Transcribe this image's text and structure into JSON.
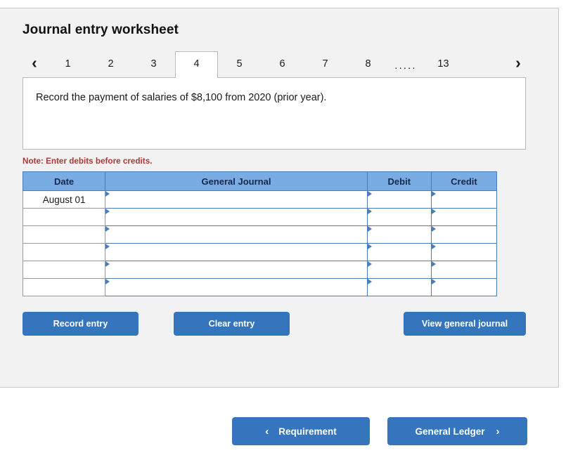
{
  "worksheet": {
    "title": "Journal entry worksheet",
    "prev_arrow": "‹",
    "next_arrow": "›",
    "tabs": [
      "1",
      "2",
      "3",
      "4",
      "5",
      "6",
      "7",
      "8"
    ],
    "tabs_ellipsis": ".....",
    "last_tab": "13",
    "active_tab": "4",
    "prompt": "Record the payment of salaries of $8,100 from 2020 (prior year).",
    "note": "Note: Enter debits before credits.",
    "table": {
      "headers": {
        "date": "Date",
        "general_journal": "General Journal",
        "debit": "Debit",
        "credit": "Credit"
      },
      "rows": [
        {
          "date": "August 01",
          "general_journal": "",
          "debit": "",
          "credit": ""
        },
        {
          "date": "",
          "general_journal": "",
          "debit": "",
          "credit": ""
        },
        {
          "date": "",
          "general_journal": "",
          "debit": "",
          "credit": ""
        },
        {
          "date": "",
          "general_journal": "",
          "debit": "",
          "credit": ""
        },
        {
          "date": "",
          "general_journal": "",
          "debit": "",
          "credit": ""
        },
        {
          "date": "",
          "general_journal": "",
          "debit": "",
          "credit": ""
        }
      ]
    },
    "actions": {
      "record_entry": "Record entry",
      "clear_entry": "Clear entry",
      "view_general_journal": "View general journal"
    }
  },
  "bottom_nav": {
    "requirement": "Requirement",
    "requirement_chevron": "‹",
    "general_ledger": "General Ledger",
    "general_ledger_chevron": "›"
  },
  "colors": {
    "header_blue": "#7aace4",
    "button_blue": "#3575be",
    "note_red": "#b03636",
    "card_bg": "#f2f2f2",
    "cell_border_blue": "#4a7ebb"
  }
}
